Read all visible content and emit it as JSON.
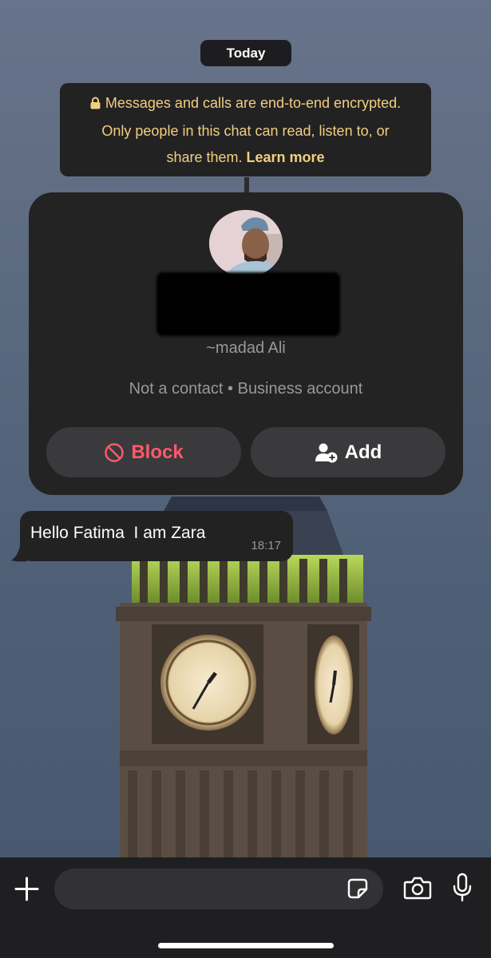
{
  "chat": {
    "date_label": "Today",
    "encryption_notice": {
      "line1": "Messages and calls are end-to-end encrypted.",
      "line2": "Only people in this chat can read, listen to, or",
      "line3": "share them.",
      "learn_more": "Learn more",
      "icon": "lock-icon",
      "text_color": "#f2cf7f"
    },
    "contact_card": {
      "alias": "~madad Ali",
      "meta": "Not a contact • Business account",
      "block_label": "Block",
      "add_label": "Add",
      "block_color": "#ff5a6a"
    },
    "messages": [
      {
        "text": "Hello Fatima  I am Zara",
        "time": "18:17",
        "direction": "incoming"
      }
    ]
  },
  "composer": {
    "input_value": "",
    "icons": [
      "plus-icon",
      "sticker-icon",
      "camera-icon",
      "microphone-icon"
    ]
  },
  "colors": {
    "bubble": "#222223",
    "card": "#232324",
    "bar": "#1f1f21"
  }
}
